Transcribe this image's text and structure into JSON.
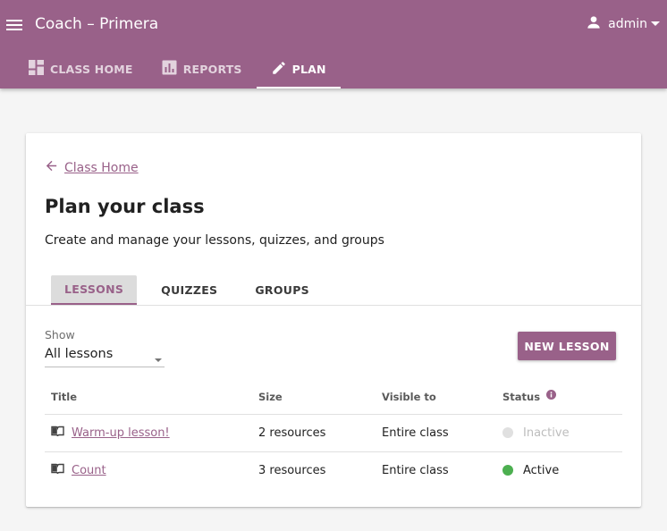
{
  "app": {
    "title": "Coach – Primera",
    "user": "admin"
  },
  "nav": {
    "tabs": [
      {
        "label": "CLASS HOME",
        "icon": "dashboard-icon"
      },
      {
        "label": "REPORTS",
        "icon": "bar-chart-icon"
      },
      {
        "label": "PLAN",
        "icon": "pencil-icon",
        "active": true
      }
    ]
  },
  "page": {
    "back_label": "Class Home",
    "title": "Plan your class",
    "subtitle": "Create and manage your lessons, quizzes, and groups"
  },
  "subtabs": [
    {
      "label": "LESSONS",
      "active": true
    },
    {
      "label": "QUIZZES"
    },
    {
      "label": "GROUPS"
    }
  ],
  "filter": {
    "label": "Show",
    "selected": "All lessons"
  },
  "new_lesson_label": "NEW LESSON",
  "table": {
    "headers": [
      "Title",
      "Size",
      "Visible to",
      "Status"
    ],
    "rows": [
      {
        "title": "Warm-up lesson!",
        "size": "2 resources",
        "visible_to": "Entire class",
        "status": "Inactive"
      },
      {
        "title": "Count",
        "size": "3 resources",
        "visible_to": "Entire class",
        "status": "Active"
      }
    ]
  },
  "colors": {
    "brand": "#996189",
    "active_status": "#4caf50",
    "inactive_status": "#e0e0e0"
  }
}
